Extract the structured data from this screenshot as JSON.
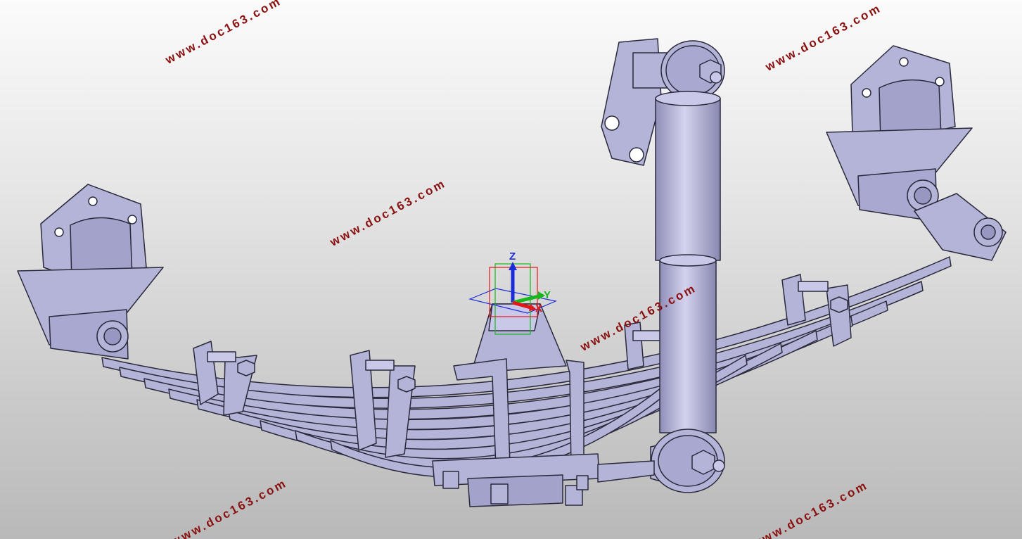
{
  "viewport": {
    "background_top": "#fbfbfb",
    "background_bottom": "#b9b9b9"
  },
  "model": {
    "part_color": "#b4b3d8",
    "edge_color": "#2a2a3c"
  },
  "compass": {
    "z_label": "Z",
    "y_label": "Y",
    "x_label": "X",
    "z_color": "#1a2bd8",
    "y_color": "#17b81d",
    "x_color": "#e01818"
  },
  "watermarks": [
    {
      "text": "www.doc163.com"
    },
    {
      "text": "www.doc163.com"
    },
    {
      "text": "www.doc163.com"
    },
    {
      "text": "www.doc163.com"
    },
    {
      "text": "www.doc163.com"
    },
    {
      "text": "www.doc163.com"
    },
    {
      "text": "www.doc163.com"
    }
  ]
}
